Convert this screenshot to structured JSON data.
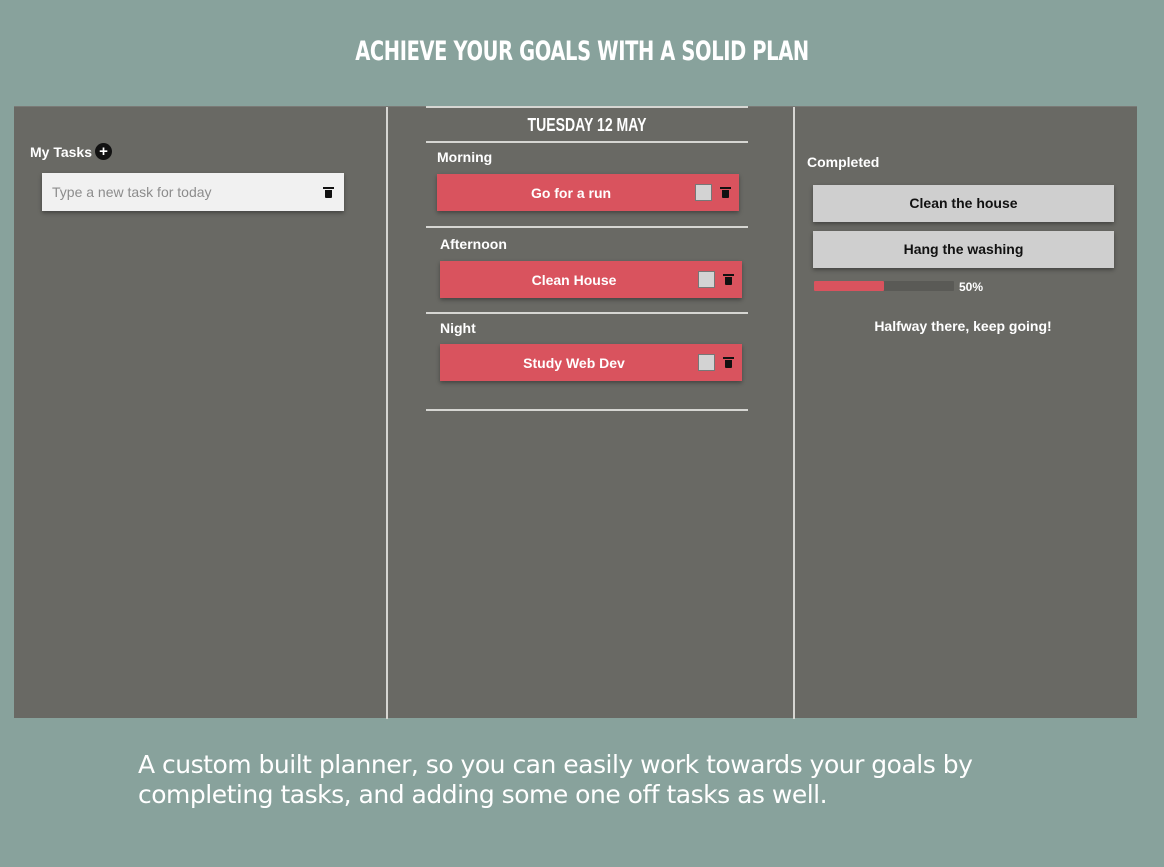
{
  "headline": "ACHIEVE YOUR GOALS WITH A SOLID PLAN",
  "left_column": {
    "title": "My Tasks",
    "add_icon": "plus-circle-icon",
    "input_placeholder": "Type a new task for today",
    "input_value": ""
  },
  "center_column": {
    "day": "TUESDAY 12 MAY",
    "sections": [
      {
        "label": "Morning",
        "task": "Go for a run",
        "checked": false
      },
      {
        "label": "Afternoon",
        "task": "Clean House",
        "checked": false
      },
      {
        "label": "Night",
        "task": "Study Web Dev",
        "checked": false
      }
    ]
  },
  "right_column": {
    "title": "Completed",
    "items": [
      "Clean the house",
      "Hang the washing"
    ],
    "progress_percent": 50,
    "progress_label": "50%",
    "message": "Halfway there, keep going!"
  },
  "caption": "A custom built planner, so you can easily work towards your goals by completing tasks, and adding some one off tasks as well.",
  "colors": {
    "background": "#88a29c",
    "panel": "#696964",
    "accent": "#d9535e",
    "card_grey": "#cfcfcf"
  }
}
